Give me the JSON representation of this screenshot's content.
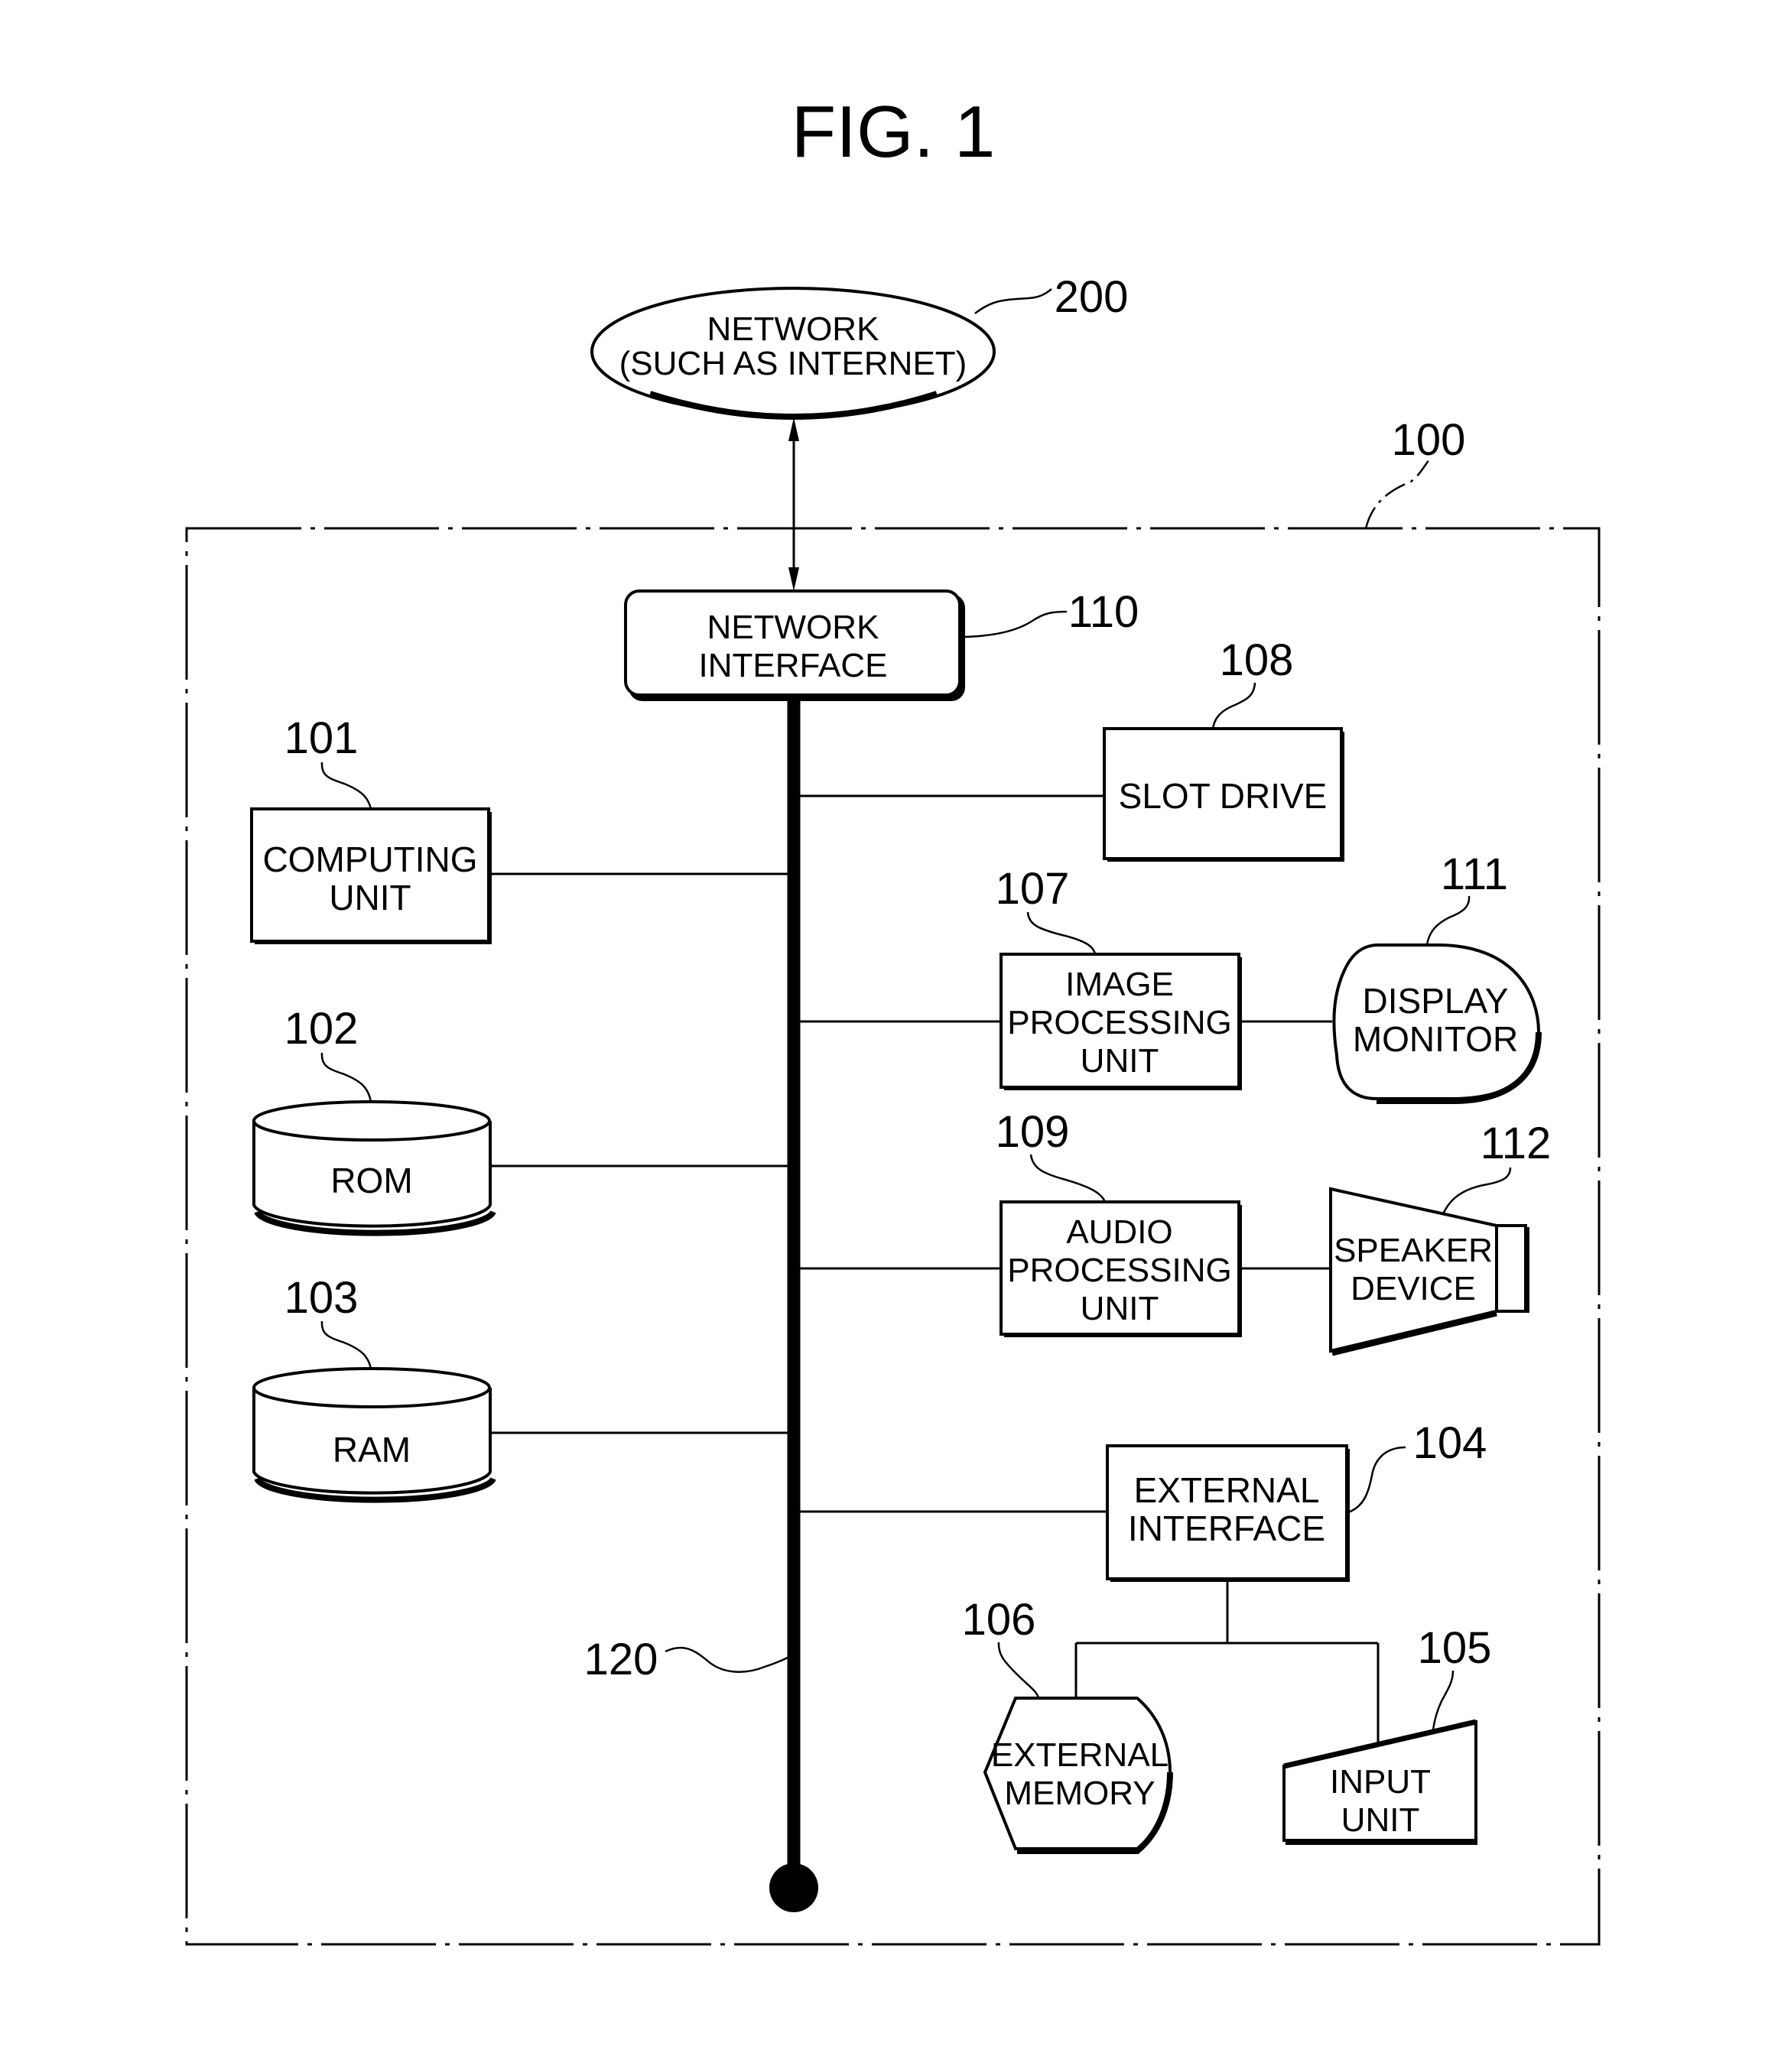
{
  "figure": {
    "title": "FIG. 1"
  },
  "network": {
    "ref": "200",
    "lines": [
      "NETWORK",
      "(SUCH AS INTERNET)"
    ]
  },
  "apparatus": {
    "ref": "100"
  },
  "bus": {
    "ref": "120"
  },
  "components": {
    "network_interface": {
      "ref": "110",
      "lines": [
        "NETWORK",
        "INTERFACE"
      ],
      "shape": "rounded-rectangle"
    },
    "computing_unit": {
      "ref": "101",
      "lines": [
        "COMPUTING",
        "UNIT"
      ],
      "shape": "rectangle"
    },
    "rom": {
      "ref": "102",
      "lines": [
        "ROM"
      ],
      "shape": "cylinder"
    },
    "ram": {
      "ref": "103",
      "lines": [
        "RAM"
      ],
      "shape": "cylinder"
    },
    "slot_drive": {
      "ref": "108",
      "lines": [
        "SLOT DRIVE"
      ],
      "shape": "rectangle"
    },
    "image_processing_unit": {
      "ref": "107",
      "lines": [
        "IMAGE",
        "PROCESSING",
        "UNIT"
      ],
      "shape": "rectangle"
    },
    "display_monitor": {
      "ref": "111",
      "lines": [
        "DISPLAY",
        "MONITOR"
      ],
      "shape": "display"
    },
    "audio_processing_unit": {
      "ref": "109",
      "lines": [
        "AUDIO",
        "PROCESSING",
        "UNIT"
      ],
      "shape": "rectangle"
    },
    "speaker_device": {
      "ref": "112",
      "lines": [
        "SPEAKER",
        "DEVICE"
      ],
      "shape": "speaker"
    },
    "external_interface": {
      "ref": "104",
      "lines": [
        "EXTERNAL",
        "INTERFACE"
      ],
      "shape": "rectangle"
    },
    "external_memory": {
      "ref": "106",
      "lines": [
        "EXTERNAL",
        "MEMORY"
      ],
      "shape": "stored-data"
    },
    "input_unit": {
      "ref": "105",
      "lines": [
        "INPUT",
        "UNIT"
      ],
      "shape": "manual-input"
    }
  },
  "connections": [
    [
      "network",
      "network_interface",
      "bidirectional-arrow"
    ],
    [
      "network_interface",
      "bus"
    ],
    [
      "computing_unit",
      "bus"
    ],
    [
      "rom",
      "bus"
    ],
    [
      "ram",
      "bus"
    ],
    [
      "slot_drive",
      "bus"
    ],
    [
      "image_processing_unit",
      "bus"
    ],
    [
      "image_processing_unit",
      "display_monitor"
    ],
    [
      "audio_processing_unit",
      "bus"
    ],
    [
      "audio_processing_unit",
      "speaker_device"
    ],
    [
      "external_interface",
      "bus"
    ],
    [
      "external_interface",
      "external_memory"
    ],
    [
      "external_interface",
      "input_unit"
    ]
  ]
}
